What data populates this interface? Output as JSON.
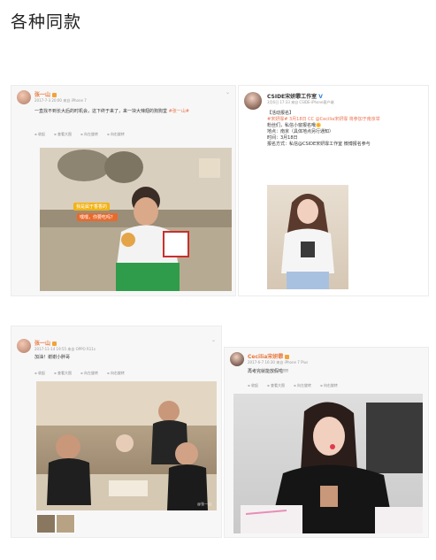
{
  "page": {
    "title": "各种同款"
  },
  "card1": {
    "username": "张一山",
    "meta": "2017-7-3 20:00 来自 iPhone 7",
    "text": "一直找不到长大后的时机会，这下终于来了，来一块大辣翅的狗狗堂",
    "text_hl": "#张一山#",
    "actions": [
      "收起",
      "查看大图",
      "向左旋转",
      "向右旋转"
    ],
    "sticker_top": "我是属于香香的",
    "sticker_bottom": "嘿嘿，你要吃吗？"
  },
  "card2": {
    "username": "CSIDE宋妍霏工作室",
    "verified": "V",
    "meta": "3月6日 17:33 来自 CSIDE-iPhone客户端",
    "line1": "【活动报名】",
    "line2": "#宋妍霏# 3月18日 CC @Cecilia宋妍霏 将参加于南京举",
    "line3": "粉丝们，私信小窗报名哦🌼",
    "line4": "地点：南京（具体地点另行通知）",
    "line5": "时间：3月18日",
    "line6": "报名方式：私信@CSIDE宋妍霏工作室 微博报名参与"
  },
  "card3": {
    "username": "张一山",
    "meta": "2017-11-14 19:55 来自 OPPO R11s",
    "text": "加油！谢谢小胖哥",
    "actions": [
      "收起",
      "查看大图",
      "向左旋转",
      "向右旋转"
    ],
    "watermark": "@张一山"
  },
  "card4": {
    "username": "Cecilia宋妍霏",
    "meta": "2017-6-7 16:30 来自 iPhone 7 Plus",
    "text": "再考完就能放假啦!!!",
    "actions": [
      "收起",
      "查看大图",
      "向左旋转",
      "向右旋转"
    ]
  },
  "colors": {
    "accent": "#eb7350",
    "badge": "#f2a33a",
    "link": "#e8773c"
  }
}
